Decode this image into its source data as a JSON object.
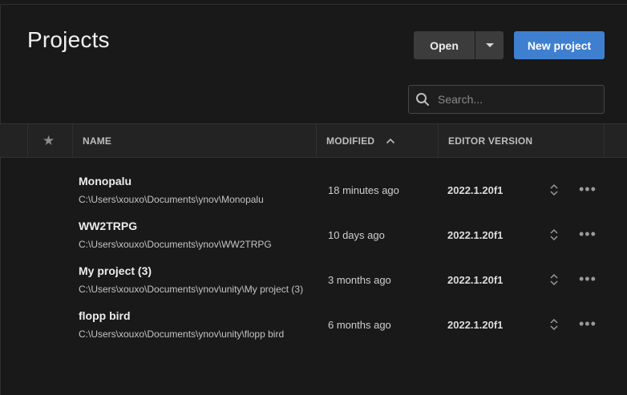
{
  "page": {
    "title": "Projects"
  },
  "toolbar": {
    "open_label": "Open",
    "open_dropdown_icon": "caret-down-icon",
    "new_project_label": "New project",
    "accent_color": "#3f7fcf"
  },
  "search": {
    "placeholder": "Search...",
    "value": "",
    "icon": "search-icon"
  },
  "table": {
    "columns": {
      "favorite_icon": "star-icon",
      "name": "NAME",
      "modified": "MODIFIED",
      "modified_sort_icon": "chevron-up-icon",
      "editor_version": "EDITOR VERSION"
    },
    "rows": [
      {
        "name": "Monopalu",
        "path": "C:\\Users\\xouxo\\Documents\\ynov\\Monopalu",
        "modified": "18 minutes ago",
        "editor_version": "2022.1.20f1"
      },
      {
        "name": "WW2TRPG",
        "path": "C:\\Users\\xouxo\\Documents\\ynov\\WW2TRPG",
        "modified": "10 days ago",
        "editor_version": "2022.1.20f1"
      },
      {
        "name": "My project (3)",
        "path": "C:\\Users\\xouxo\\Documents\\ynov\\unity\\My project (3)",
        "modified": "3 months ago",
        "editor_version": "2022.1.20f1"
      },
      {
        "name": "flopp bird",
        "path": "C:\\Users\\xouxo\\Documents\\ynov\\unity\\flopp bird",
        "modified": "6 months ago",
        "editor_version": "2022.1.20f1"
      }
    ],
    "more_icon": "more-horizontal-icon",
    "version_select_icon": "chevron-up-down-icon"
  }
}
